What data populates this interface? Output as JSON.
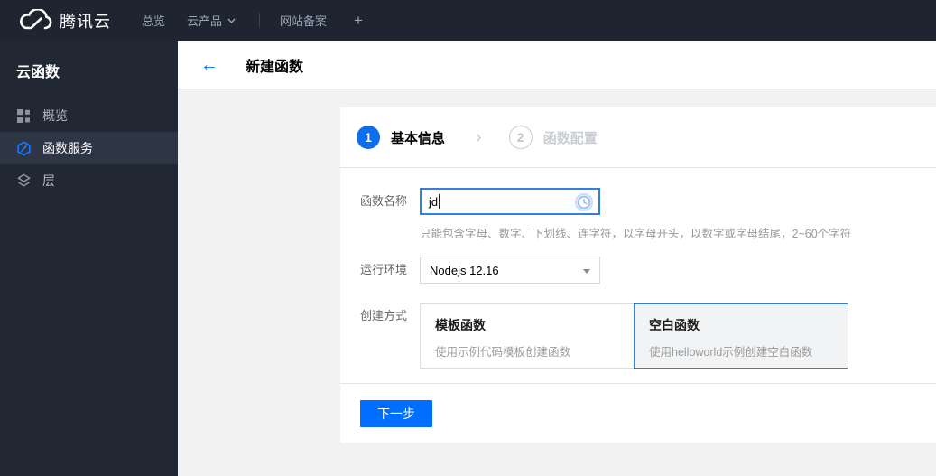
{
  "topbar": {
    "brand": "腾讯云",
    "nav": [
      {
        "label": "总览"
      },
      {
        "label": "云产品"
      },
      {
        "label": "网站备案"
      }
    ],
    "add_label": "+"
  },
  "sidebar": {
    "title": "云函数",
    "items": [
      {
        "label": "概览",
        "icon": "grid-icon",
        "active": false
      },
      {
        "label": "函数服务",
        "icon": "function-service-icon",
        "active": true
      },
      {
        "label": "层",
        "icon": "layers-icon",
        "active": false
      }
    ]
  },
  "header": {
    "back_icon": "←",
    "title": "新建函数"
  },
  "wizard": {
    "steps": [
      {
        "number": "1",
        "label": "基本信息",
        "active": true
      },
      {
        "number": "2",
        "label": "函数配置",
        "active": false
      }
    ],
    "arrow": "›"
  },
  "form": {
    "name": {
      "label": "函数名称",
      "value": "jd",
      "status_icon": "clock-pending-icon",
      "help": "只能包含字母、数字、下划线、连字符，以字母开头，以数字或字母结尾，2~60个字符"
    },
    "runtime": {
      "label": "运行环境",
      "value": "Nodejs 12.16"
    },
    "method": {
      "label": "创建方式",
      "options": [
        {
          "title": "模板函数",
          "desc": "使用示例代码模板创建函数",
          "selected": false
        },
        {
          "title": "空白函数",
          "desc": "使用helloworld示例创建空白函数",
          "selected": true
        }
      ]
    }
  },
  "footer": {
    "next_label": "下一步"
  },
  "colors": {
    "accent": "#006eff",
    "focus_border": "#3080e0",
    "topbar_bg": "#1e2430",
    "sidebar_bg": "#222833",
    "sidebar_active_bg": "#2e3544",
    "content_bg": "#f2f2f2",
    "muted_text": "#999999",
    "step_inactive": "#c9cdd3"
  }
}
